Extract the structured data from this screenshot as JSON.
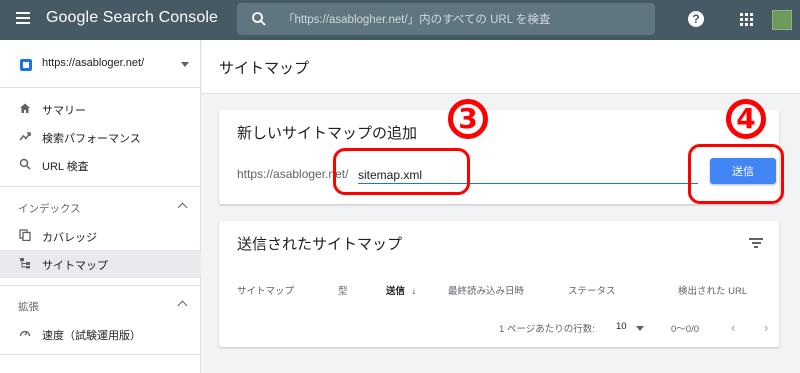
{
  "topbar": {
    "brand": "Google Search Console",
    "search_placeholder": "「https://asablogher.net/」内のすべての URL を検査",
    "help": "?"
  },
  "sidebar": {
    "property": "https://asabloger.net/",
    "items_top": [
      {
        "icon": "home-icon",
        "label": "サマリー"
      },
      {
        "icon": "trending-up-icon",
        "label": "検索パフォーマンス"
      },
      {
        "icon": "search-icon",
        "label": "URL 検査"
      }
    ],
    "index_section": {
      "label": "インデックス",
      "items": [
        {
          "icon": "copy-icon",
          "label": "カバレッジ"
        },
        {
          "icon": "sitemap-icon",
          "label": "サイトマップ"
        }
      ]
    },
    "ext_section": {
      "label": "拡張",
      "items": [
        {
          "icon": "speed-icon",
          "label": "速度（試験運用版）"
        }
      ]
    }
  },
  "main": {
    "page_title": "サイトマップ",
    "add_card": {
      "title": "新しいサイトマップの追加",
      "url_prefix": "https://asabloger.net/",
      "input_value": "sitemap.xml",
      "submit_label": "送信"
    },
    "submitted_card": {
      "title": "送信されたサイトマップ",
      "columns": [
        "サイトマップ",
        "型",
        "送信",
        "最終読み込み日時",
        "ステータス",
        "検出された URL"
      ],
      "sorted_column": "送信",
      "rows_per_page_label": "1 ページあたりの行数:",
      "rows_per_page_value": "10",
      "range": "0〜0/0"
    }
  },
  "annotations": {
    "label_3": "3",
    "label_4": "4",
    "color": "#ff0000"
  },
  "colors": {
    "topbar": "#455a64",
    "accent": "#1a73e8",
    "button": "#4285f4"
  }
}
